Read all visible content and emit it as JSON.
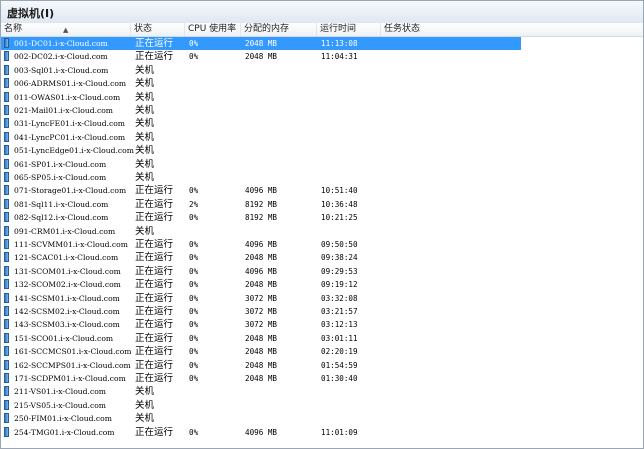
{
  "panel": {
    "title": "虚拟机(I)"
  },
  "columns": {
    "name": "名称",
    "state": "状态",
    "cpu": "CPU 使用率",
    "memory": "分配的内存",
    "uptime": "运行时间",
    "task": "任务状态"
  },
  "selected_row": 0,
  "vms": [
    {
      "name": "001-DC01.i-x-Cloud.com",
      "state": "正在运行",
      "cpu": "0%",
      "memory": "2048 MB",
      "uptime": "11:13:08"
    },
    {
      "name": "002-DC02.i-x-Cloud.com",
      "state": "正在运行",
      "cpu": "0%",
      "memory": "2048 MB",
      "uptime": "11:04:31"
    },
    {
      "name": "003-Sql01.i-x-Cloud.com",
      "state": "关机",
      "cpu": "",
      "memory": "",
      "uptime": ""
    },
    {
      "name": "006-ADRMS01.i-x-Cloud.com",
      "state": "关机",
      "cpu": "",
      "memory": "",
      "uptime": ""
    },
    {
      "name": "011-OWAS01.i-x-Cloud.com",
      "state": "关机",
      "cpu": "",
      "memory": "",
      "uptime": ""
    },
    {
      "name": "021-Mail01.i-x-Cloud.com",
      "state": "关机",
      "cpu": "",
      "memory": "",
      "uptime": ""
    },
    {
      "name": "031-LyncFE01.i-x-Cloud.com",
      "state": "关机",
      "cpu": "",
      "memory": "",
      "uptime": ""
    },
    {
      "name": "041-LyncPC01.i-x-Cloud.com",
      "state": "关机",
      "cpu": "",
      "memory": "",
      "uptime": ""
    },
    {
      "name": "051-LyncEdge01.i-x-Cloud.com",
      "state": "关机",
      "cpu": "",
      "memory": "",
      "uptime": ""
    },
    {
      "name": "061-SP01.i-x-Cloud.com",
      "state": "关机",
      "cpu": "",
      "memory": "",
      "uptime": ""
    },
    {
      "name": "065-SP05.i-x-Cloud.com",
      "state": "关机",
      "cpu": "",
      "memory": "",
      "uptime": ""
    },
    {
      "name": "071-Storage01.i-x-Cloud.com",
      "state": "正在运行",
      "cpu": "0%",
      "memory": "4096 MB",
      "uptime": "10:51:40"
    },
    {
      "name": "081-Sql11.i-x-Cloud.com",
      "state": "正在运行",
      "cpu": "2%",
      "memory": "8192 MB",
      "uptime": "10:36:48"
    },
    {
      "name": "082-Sql12.i-x-Cloud.com",
      "state": "正在运行",
      "cpu": "0%",
      "memory": "8192 MB",
      "uptime": "10:21:25"
    },
    {
      "name": "091-CRM01.i-x-Cloud.com",
      "state": "关机",
      "cpu": "",
      "memory": "",
      "uptime": ""
    },
    {
      "name": "111-SCVMM01.i-x-Cloud.com",
      "state": "正在运行",
      "cpu": "0%",
      "memory": "4096 MB",
      "uptime": "09:50:50"
    },
    {
      "name": "121-SCAC01.i-x-Cloud.com",
      "state": "正在运行",
      "cpu": "0%",
      "memory": "2048 MB",
      "uptime": "09:38:24"
    },
    {
      "name": "131-SCOM01.i-x-Cloud.com",
      "state": "正在运行",
      "cpu": "0%",
      "memory": "4096 MB",
      "uptime": "09:29:53"
    },
    {
      "name": "132-SCOM02.i-x-Cloud.com",
      "state": "正在运行",
      "cpu": "0%",
      "memory": "2048 MB",
      "uptime": "09:19:12"
    },
    {
      "name": "141-SCSM01.i-x-Cloud.com",
      "state": "正在运行",
      "cpu": "0%",
      "memory": "3072 MB",
      "uptime": "03:32:08"
    },
    {
      "name": "142-SCSM02.i-x-Cloud.com",
      "state": "正在运行",
      "cpu": "0%",
      "memory": "3072 MB",
      "uptime": "03:21:57"
    },
    {
      "name": "143-SCSM03.i-x-Cloud.com",
      "state": "正在运行",
      "cpu": "0%",
      "memory": "3072 MB",
      "uptime": "03:12:13"
    },
    {
      "name": "151-SCO01.i-x-Cloud.com",
      "state": "正在运行",
      "cpu": "0%",
      "memory": "2048 MB",
      "uptime": "03:01:11"
    },
    {
      "name": "161-SCCMCS01.i-x-Cloud.com",
      "state": "正在运行",
      "cpu": "0%",
      "memory": "2048 MB",
      "uptime": "02:20:19"
    },
    {
      "name": "162-SCCMPS01.i-x-Cloud.com",
      "state": "正在运行",
      "cpu": "0%",
      "memory": "2048 MB",
      "uptime": "01:54:59"
    },
    {
      "name": "171-SCDPM01.i-x-Cloud.com",
      "state": "正在运行",
      "cpu": "0%",
      "memory": "2048 MB",
      "uptime": "01:30:40"
    },
    {
      "name": "211-VS01.i-x-Cloud.com",
      "state": "关机",
      "cpu": "",
      "memory": "",
      "uptime": ""
    },
    {
      "name": "215-VS05.i-x-Cloud.com",
      "state": "关机",
      "cpu": "",
      "memory": "",
      "uptime": ""
    },
    {
      "name": "250-FIM01.i-x-Cloud.com",
      "state": "关机",
      "cpu": "",
      "memory": "",
      "uptime": ""
    },
    {
      "name": "254-TMG01.i-x-Cloud.com",
      "state": "正在运行",
      "cpu": "0%",
      "memory": "4096 MB",
      "uptime": "11:01:09"
    }
  ]
}
